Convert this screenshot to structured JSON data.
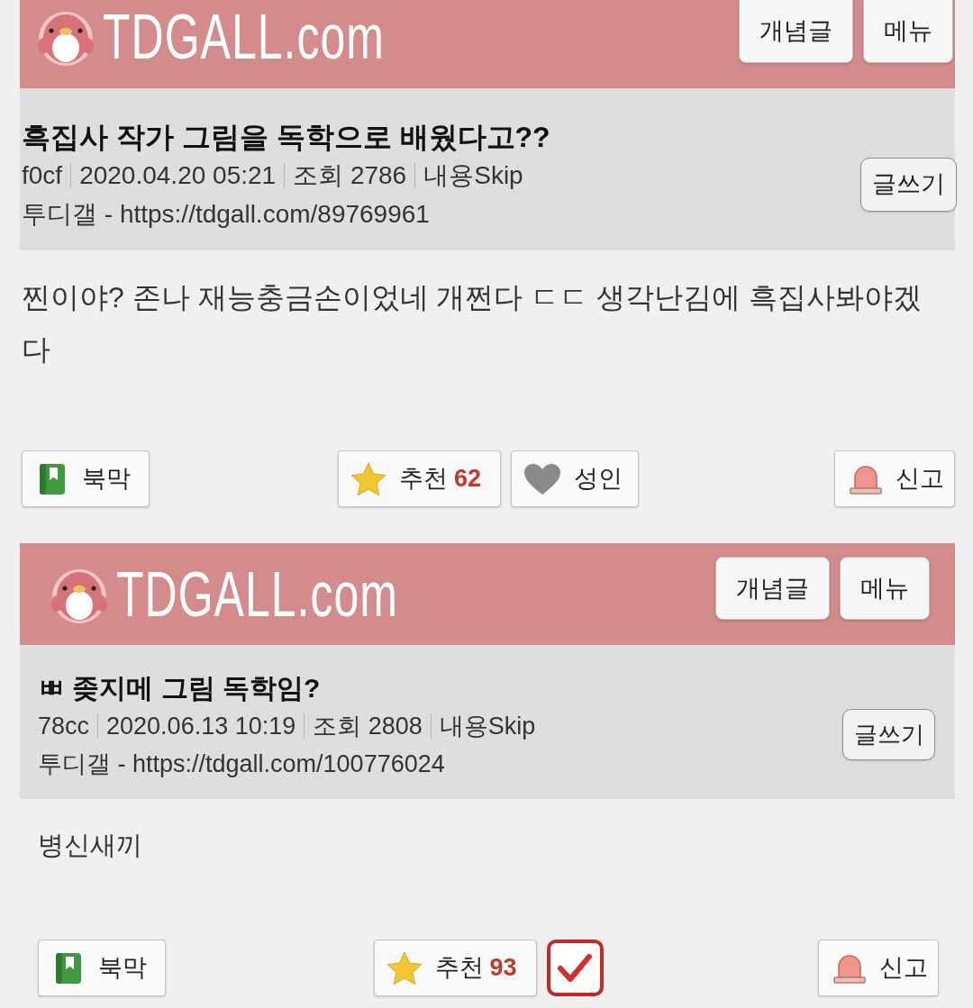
{
  "posts": [
    {
      "site": {
        "logo_text": "TDGALL.com",
        "buttons": [
          "개념글",
          "메뉴"
        ]
      },
      "header": {
        "title": "흑집사 작가 그림을 독학으로 배웠다고??",
        "meta": {
          "author": "f0cf",
          "date": "2020.04.20 05:21",
          "views": "조회 2786",
          "skip": "내용Skip"
        },
        "url_line": "투디갤 - https://tdgall.com/89769961",
        "write_button": "글쓰기"
      },
      "body": "찐이야? 존나 재능충금손이었네 개쩐다 ㄷㄷ 생각난김에 흑집사봐야겠다",
      "actions": [
        {
          "kind": "bookmark",
          "label": "북막"
        },
        {
          "kind": "recommend",
          "label": "추천",
          "count": "62"
        },
        {
          "kind": "adult",
          "label": "성인"
        },
        {
          "kind": "report",
          "label": "신고"
        }
      ]
    },
    {
      "site": {
        "logo_text": "TDGALL.com",
        "buttons": [
          "개념글",
          "메뉴"
        ]
      },
      "header": {
        "title": "ㅃ 좆지메 그림 독학임?",
        "meta": {
          "author": "78cc",
          "date": "2020.06.13 10:19",
          "views": "조회 2808",
          "skip": "내용Skip"
        },
        "url_line": "투디갤 - https://tdgall.com/100776024",
        "write_button": "글쓰기"
      },
      "body": "병신새끼",
      "actions": [
        {
          "kind": "bookmark",
          "label": "북막"
        },
        {
          "kind": "recommend",
          "label": "추천",
          "count": "93"
        },
        {
          "kind": "check",
          "checked": true
        },
        {
          "kind": "report",
          "label": "신고"
        }
      ]
    }
  ]
}
